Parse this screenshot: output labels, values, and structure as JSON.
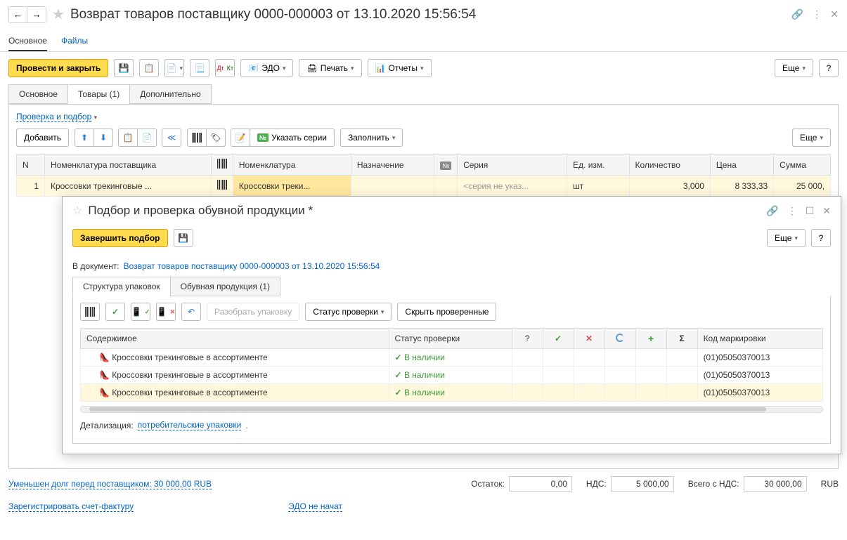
{
  "header": {
    "title": "Возврат товаров поставщику 0000-000003 от 13.10.2020 15:56:54"
  },
  "nav": {
    "main": "Основное",
    "files": "Файлы"
  },
  "toolbar": {
    "post_close": "Провести и закрыть",
    "edo": "ЭДО",
    "print": "Печать",
    "reports": "Отчеты",
    "more": "Еще",
    "help": "?"
  },
  "doc_tabs": {
    "main": "Основное",
    "goods": "Товары (1)",
    "extra": "Дополнительно"
  },
  "check_select": "Проверка и подбор",
  "sub_toolbar": {
    "add": "Добавить",
    "series": "Указать серии",
    "fill": "Заполнить",
    "more": "Еще"
  },
  "table": {
    "cols": {
      "n": "N",
      "supplier_item": "Номенклатура поставщика",
      "item": "Номенклатура",
      "purpose": "Назначение",
      "series": "Серия",
      "unit": "Ед. изм.",
      "qty": "Количество",
      "price": "Цена",
      "sum": "Сумма"
    },
    "rows": [
      {
        "n": "1",
        "supplier_item": "Кроссовки трекинговые ...",
        "item": "Кроссовки треки...",
        "series": "<серия не указ...",
        "unit": "шт",
        "qty": "3,000",
        "price": "8 333,33",
        "sum": "25 000,"
      }
    ]
  },
  "modal": {
    "title": "Подбор и проверка обувной продукции *",
    "finish": "Завершить подбор",
    "more": "Еще",
    "help": "?",
    "doc_label": "В документ:",
    "doc_link": "Возврат товаров поставщику 0000-000003 от 13.10.2020 15:56:54",
    "tabs": {
      "structure": "Структура упаковок",
      "shoes": "Обувная продукция (1)"
    },
    "inner_toolbar": {
      "unpack": "Разобрать упаковку",
      "status": "Статус проверки",
      "hide": "Скрыть проверенные"
    },
    "inner_cols": {
      "content": "Содержимое",
      "status": "Статус проверки",
      "q": "?",
      "mark": "Код маркировки"
    },
    "inner_rows": [
      {
        "name": "Кроссовки трекинговые в ассортименте",
        "status": "В наличии",
        "code": "(01)05050370013"
      },
      {
        "name": "Кроссовки трекинговые в ассортименте",
        "status": "В наличии",
        "code": "(01)05050370013"
      },
      {
        "name": "Кроссовки трекинговые в ассортименте",
        "status": "В наличии",
        "code": "(01)05050370013"
      }
    ],
    "detail_label": "Детализация:",
    "detail_link": "потребительские упаковки"
  },
  "footer": {
    "debt_link": "Уменьшен долг перед поставщиком: 30 000,00 RUB",
    "invoice_link": "Зарегистрировать счет-фактуру",
    "edo_status": "ЭДО не начат",
    "remain_label": "Остаток:",
    "remain_val": "0,00",
    "vat_label": "НДС:",
    "vat_val": "5 000,00",
    "total_label": "Всего с НДС:",
    "total_val": "30 000,00",
    "currency": "RUB"
  }
}
